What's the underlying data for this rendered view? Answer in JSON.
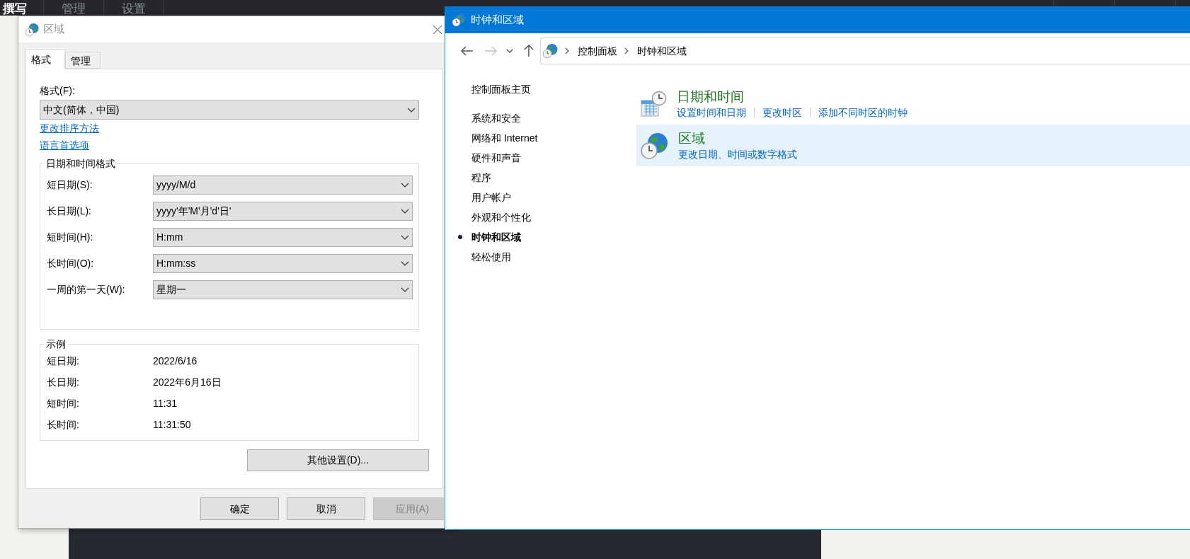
{
  "app_tabs": [
    {
      "label": "撰写",
      "selected": true
    },
    {
      "label": "管理",
      "selected": false
    },
    {
      "label": "设置",
      "selected": false
    }
  ],
  "region_dialog": {
    "title": "区域",
    "tabs": [
      {
        "label": "格式",
        "selected": true
      },
      {
        "label": "管理",
        "selected": false
      }
    ],
    "format_label": "格式(F):",
    "format_value": "中文(简体，中国)",
    "links": [
      "更改排序方法",
      "语言首选项"
    ],
    "datetime_group": {
      "title": "日期和时间格式",
      "rows": [
        {
          "label": "短日期(S):",
          "value": "yyyy/M/d"
        },
        {
          "label": "长日期(L):",
          "value": "yyyy'年'M'月'd'日'"
        },
        {
          "label": "短时间(H):",
          "value": "H:mm"
        },
        {
          "label": "长时间(O):",
          "value": "H:mm:ss"
        },
        {
          "label": "一周的第一天(W):",
          "value": "星期一"
        }
      ]
    },
    "example_group": {
      "title": "示例",
      "rows": [
        {
          "label": "短日期:",
          "value": "2022/6/16"
        },
        {
          "label": "长日期:",
          "value": "2022年6月16日"
        },
        {
          "label": "短时间:",
          "value": "11:31"
        },
        {
          "label": "长时间:",
          "value": "11:31:50"
        }
      ]
    },
    "other_settings_button": "其他设置(D)...",
    "buttons": [
      {
        "label": "确定",
        "disabled": false
      },
      {
        "label": "取消",
        "disabled": false
      },
      {
        "label": "应用(A)",
        "disabled": true
      }
    ]
  },
  "control_panel": {
    "title": "时钟和区域",
    "nav": [
      {
        "kind": "back",
        "disabled": false
      },
      {
        "kind": "forward",
        "disabled": true
      },
      {
        "kind": "recent",
        "disabled": false
      },
      {
        "kind": "up",
        "disabled": false
      }
    ],
    "breadcrumb": [
      "控制面板",
      "时钟和区域"
    ],
    "sidebar": {
      "home": "控制面板主页",
      "items": [
        {
          "label": "系统和安全",
          "selected": false
        },
        {
          "label": "网络和 Internet",
          "selected": false
        },
        {
          "label": "硬件和声音",
          "selected": false
        },
        {
          "label": "程序",
          "selected": false
        },
        {
          "label": "用户帐户",
          "selected": false
        },
        {
          "label": "外观和个性化",
          "selected": false
        },
        {
          "label": "时钟和区域",
          "selected": true
        },
        {
          "label": "轻松使用",
          "selected": false
        }
      ]
    },
    "sections": [
      {
        "kind": "datetime",
        "title": "日期和时间",
        "highlighted": false,
        "links": [
          "设置时间和日期",
          "更改时区",
          "添加不同时区的时钟"
        ]
      },
      {
        "kind": "region",
        "title": "区域",
        "highlighted": true,
        "links": [
          "更改日期、时间或数字格式"
        ]
      }
    ]
  }
}
